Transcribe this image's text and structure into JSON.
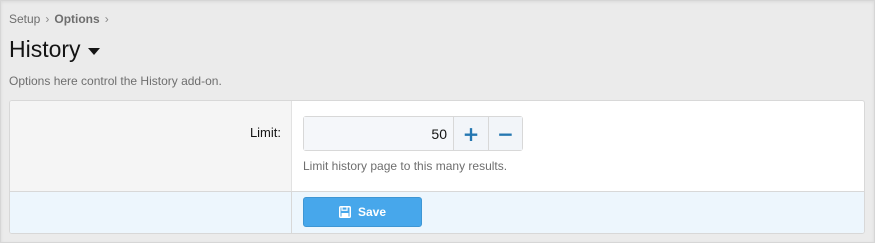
{
  "breadcrumb": {
    "items": [
      {
        "label": "Setup"
      },
      {
        "label": "Options"
      }
    ],
    "separator": "›"
  },
  "page": {
    "title": "History",
    "description": "Options here control the History add-on."
  },
  "form": {
    "limit": {
      "label": "Limit:",
      "value": "50",
      "increment_icon": "+",
      "decrement_icon": "−",
      "explain": "Limit history page to this many results."
    },
    "save_label": "Save",
    "save_icon": "floppy-disk-icon"
  },
  "colors": {
    "accent": "#47a7eb",
    "stepper": "#2577b1",
    "submit_bg": "#edf6fd",
    "label_bg": "#f5f5f5"
  }
}
